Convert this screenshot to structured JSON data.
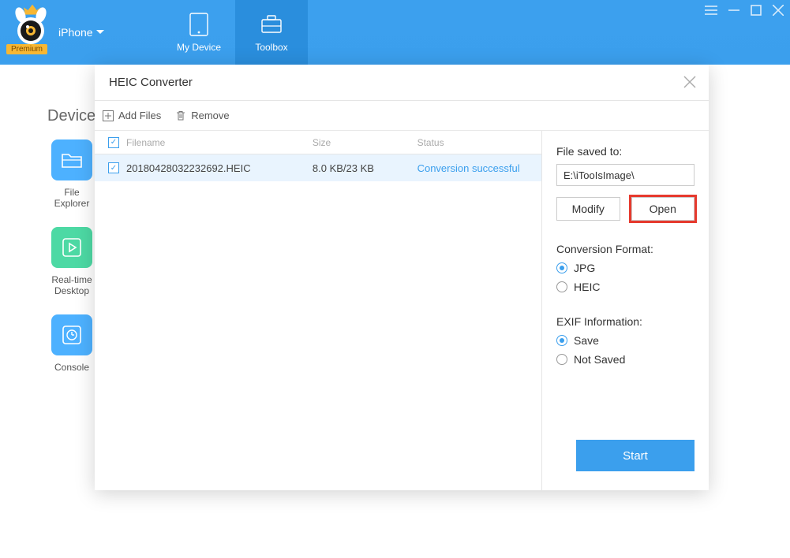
{
  "header": {
    "premium_label": "Premium",
    "device_label": "iPhone",
    "tabs": {
      "my_device": "My Device",
      "toolbox": "Toolbox"
    }
  },
  "background": {
    "section_title": "Device",
    "items": {
      "file_explorer": "File\nExplorer",
      "realtime_desktop": "Real-time\nDesktop",
      "console": "Console"
    }
  },
  "modal": {
    "title": "HEIC Converter",
    "toolbar": {
      "add_files": "Add Files",
      "remove": "Remove"
    },
    "columns": {
      "filename": "Filename",
      "size": "Size",
      "status": "Status"
    },
    "files": [
      {
        "name": "20180428032232692.HEIC",
        "size": "8.0 KB/23 KB",
        "status": "Conversion successful",
        "checked": true
      }
    ],
    "side": {
      "saved_label": "File saved to:",
      "save_path": "E:\\iTooIsImage\\",
      "modify": "Modify",
      "open": "Open",
      "format_label": "Conversion Format:",
      "format_jpg": "JPG",
      "format_heic": "HEIC",
      "exif_label": "EXIF Information:",
      "exif_save": "Save",
      "exif_not": "Not Saved",
      "start": "Start"
    }
  }
}
